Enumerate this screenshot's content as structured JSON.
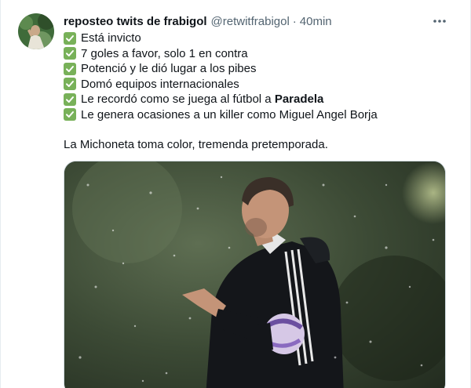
{
  "tweet": {
    "display_name": "reposteo twits de frabigol",
    "handle": "@retwitfrabigol",
    "separator": "·",
    "time": "40min",
    "lines": [
      {
        "text": "Está invicto"
      },
      {
        "text": "7 goles a favor, solo 1 en contra"
      },
      {
        "text": "Potenció y le dió lugar a los pibes"
      },
      {
        "text": "Domó equipos internacionales"
      },
      {
        "text": "Le recordó como se juega al fútbol a ",
        "bold": "Paradela"
      },
      {
        "text": "Le genera ocasiones a un killer como Miguel Angel Borja"
      }
    ],
    "extra_text": "La Michoneta toma color, tremenda pretemporada."
  },
  "icons": {
    "check": "check-mark-button-icon",
    "more": "more-icon"
  },
  "colors": {
    "check_green": "#78b159",
    "secondary_text": "#536471",
    "border": "#e6ecf0"
  }
}
